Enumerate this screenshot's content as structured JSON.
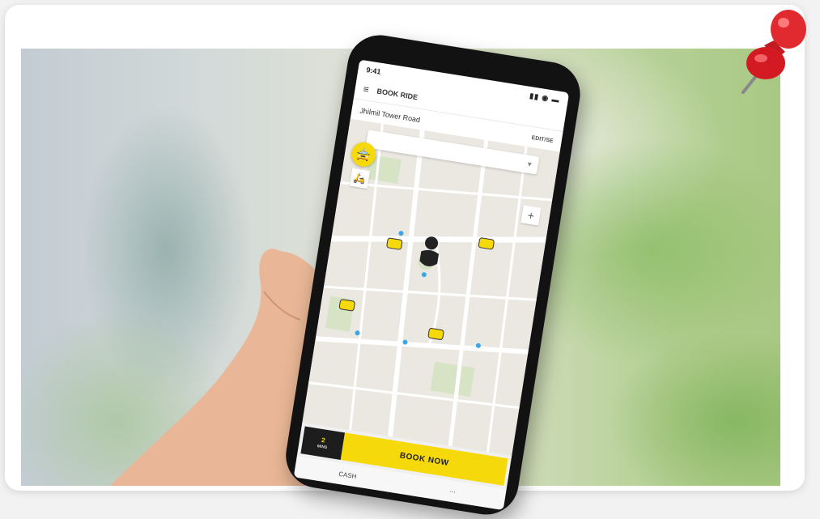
{
  "app": {
    "status_time": "9:41",
    "status_icons": "▮▮ ◉ ▬",
    "menu_glyph": "≡",
    "title": "BOOK RIDE",
    "pickup_address": "Jhilmil Tower Road",
    "edit_label": "EDIT/SE",
    "drop_glyph": "▾",
    "car_glyph": "🚖",
    "bike_glyph": "🛵",
    "zoom_glyph": "+",
    "fare_amount": "2",
    "fare_sub": "MINS",
    "book_label": "BOOK NOW",
    "payment_method": "CASH",
    "payment_alt": "⋯"
  },
  "colors": {
    "accent": "#f5d90a",
    "dark": "#1d1d1d",
    "pin": "#d31a22"
  },
  "icons": {
    "pushpin": "pushpin-icon",
    "user_location": "user-location-icon",
    "cab_marker": "cab-marker-icon"
  }
}
